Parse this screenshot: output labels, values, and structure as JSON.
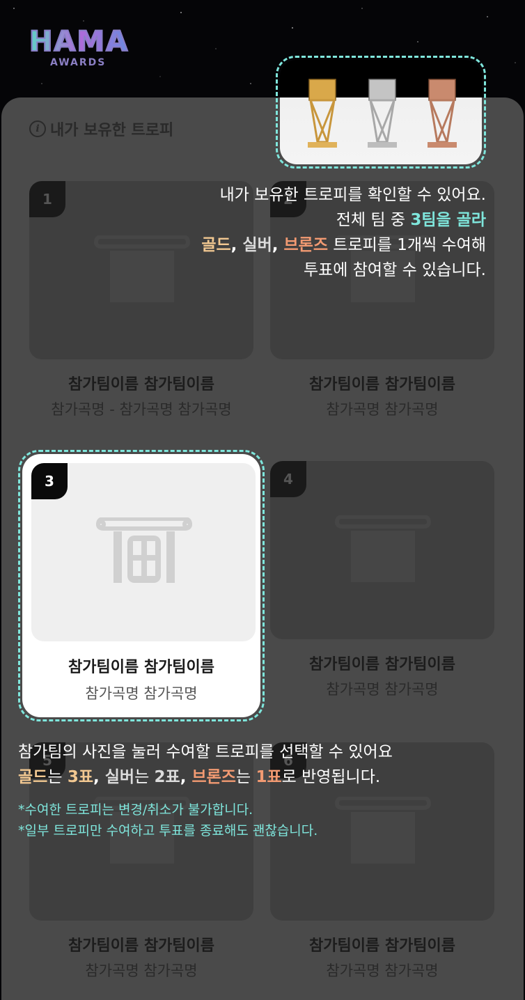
{
  "logo": {
    "main": "HAMA",
    "sub": "AWARDS"
  },
  "panel": {
    "title": "내가 보유한 트로피",
    "info_icon": "info-icon"
  },
  "trophies": [
    {
      "name": "gold",
      "color": "#d9a84a"
    },
    {
      "name": "silver",
      "color": "#b8b8b8"
    },
    {
      "name": "bronze",
      "color": "#c98a6e"
    }
  ],
  "guide_top": {
    "line1": "내가 보유한 트로피를 확인할 수 있어요.",
    "line2_pre": "전체 팀 중 ",
    "line2_em": "3팀을 골라",
    "line3_gold": "골드",
    "line3_sep1": ", ",
    "line3_silver": "실버",
    "line3_sep2": ", ",
    "line3_bronze": "브론즈",
    "line3_post": " 트로피를 1개씩 수여해",
    "line4": "투표에 참여할 수 있습니다."
  },
  "cards": [
    {
      "num": "1",
      "team": "참가팀이름 참가팀이름",
      "song": "참가곡명 - 참가곡명 참가곡명"
    },
    {
      "num": "2",
      "team": "참가팀이름 참가팀이름",
      "song": "참가곡명 참가곡명"
    },
    {
      "num": "3",
      "team": "참가팀이름 참가팀이름",
      "song": "참가곡명 참가곡명"
    },
    {
      "num": "4",
      "team": "참가팀이름 참가팀이름",
      "song": "참가곡명 참가곡명"
    },
    {
      "num": "5",
      "team": "참가팀이름 참가팀이름",
      "song": "참가곡명 참가곡명"
    },
    {
      "num": "6",
      "team": "참가팀이름 참가팀이름",
      "song": "참가곡명 참가곡명"
    }
  ],
  "guide_bottom": {
    "line1": "참가팀의 사진을 눌러 수여할 트로피를 선택할 수 있어요",
    "gold": "골드",
    "gold_post": "는 ",
    "gold_votes": "3표",
    "sep1": ", ",
    "silver": "실버",
    "silver_post": "는 ",
    "silver_votes": "2표",
    "sep2": ", ",
    "bronze": "브론즈",
    "bronze_post": "는 ",
    "bronze_votes": "1표",
    "end": "로 반영됩니다."
  },
  "notes": [
    "*수여한 트로피는 변경/취소가 불가합니다.",
    "*일부 트로피만 수여하고 투표를 종료해도 괜찮습니다."
  ]
}
